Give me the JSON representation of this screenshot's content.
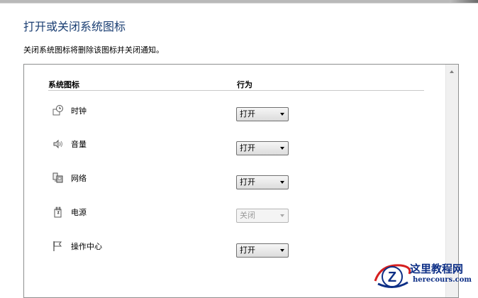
{
  "page": {
    "title": "打开或关闭系统图标",
    "description": "关闭系统图标将删除该图标并关闭通知。"
  },
  "table": {
    "headers": {
      "icon": "系统图标",
      "behavior": "行为"
    },
    "rows": [
      {
        "label": "时钟",
        "icon": "clock-icon",
        "value": "打开",
        "enabled": true
      },
      {
        "label": "音量",
        "icon": "volume-icon",
        "value": "打开",
        "enabled": true
      },
      {
        "label": "网络",
        "icon": "network-icon",
        "value": "打开",
        "enabled": true
      },
      {
        "label": "电源",
        "icon": "power-icon",
        "value": "关闭",
        "enabled": false
      },
      {
        "label": "操作中心",
        "icon": "action-center-flag-icon",
        "value": "打开",
        "enabled": true
      }
    ]
  },
  "watermark": {
    "title": "这里教程网",
    "url": "herecours.com",
    "logo_letter": "Z",
    "colors": {
      "primary": "#0d2f86",
      "accent": "#d62020"
    }
  },
  "colors": {
    "title": "#1b3f73",
    "panel_border": "#8e8f8f"
  }
}
